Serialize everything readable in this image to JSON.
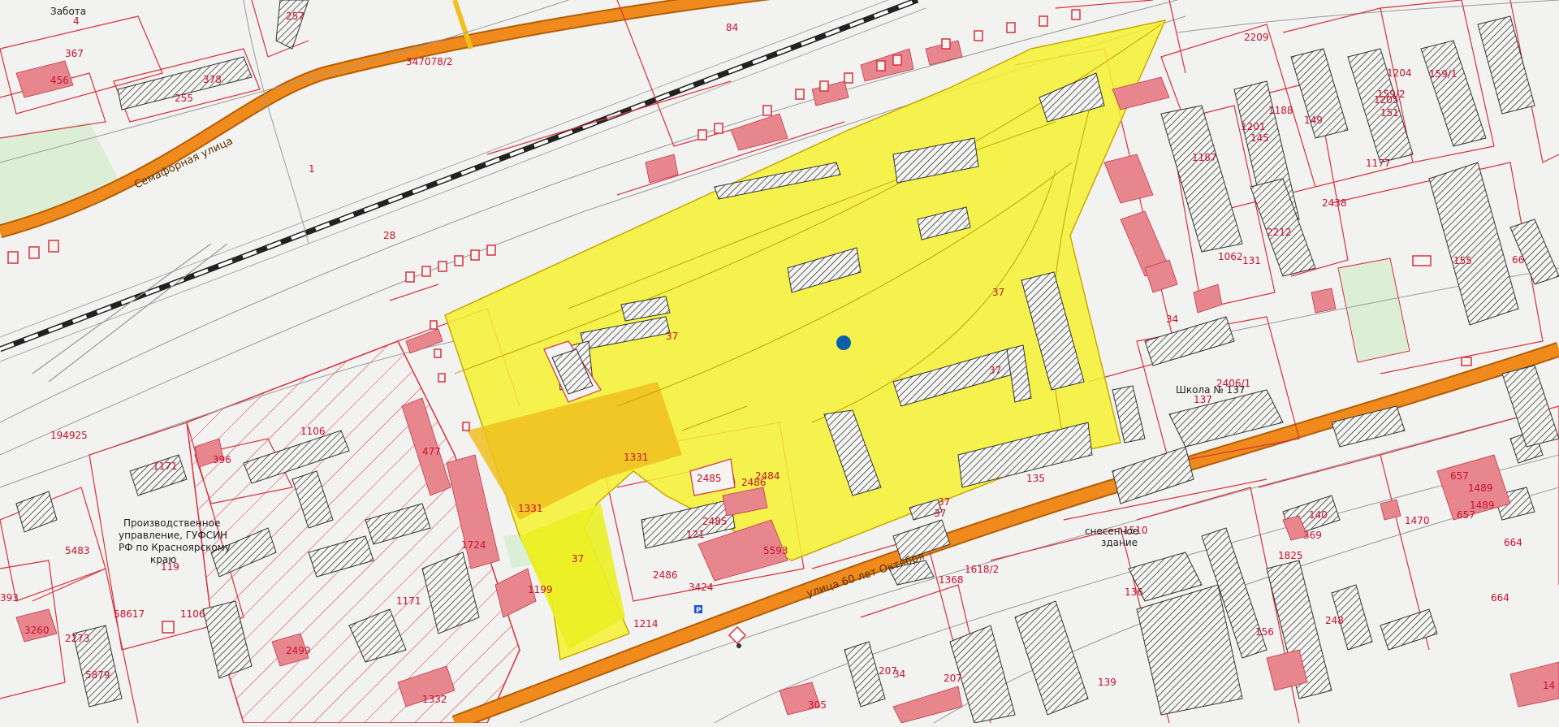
{
  "map": {
    "streets": [
      {
        "name": "Семафорная улица"
      },
      {
        "name": "улица 60 лет Октября"
      }
    ],
    "parcel_numbers": [
      "4",
      "257",
      "367",
      "456",
      "378",
      "255",
      "347078/2",
      "84",
      "1",
      "28",
      "194925",
      "1106",
      "396",
      "1171",
      "5483",
      "119",
      "1171",
      "1106",
      "2499",
      "393",
      "58617",
      "2273",
      "3260",
      "5879",
      "1332",
      "477",
      "1724",
      "37",
      "1331",
      "1331",
      "37",
      "2485",
      "2486",
      "2484",
      "2485",
      "121",
      "5593",
      "2486",
      "3424",
      "1199",
      "1214",
      "37",
      "37",
      "37",
      "135",
      "37",
      "1368",
      "1618/2",
      "305",
      "207",
      "34",
      "207",
      "139",
      "2209",
      "1204",
      "159/1",
      "159/2",
      "1205",
      "1188",
      "149",
      "151",
      "1201",
      "145",
      "1187",
      "1177",
      "2438",
      "1062",
      "131",
      "2212",
      "155",
      "66",
      "34",
      "2406/1",
      "137",
      "664",
      "657",
      "1489",
      "1489",
      "657",
      "1470",
      "140",
      "1825",
      "369",
      "1510",
      "136",
      "156",
      "248",
      "664",
      "14"
    ],
    "labels": {
      "zabota": "Забота",
      "gufsin_1": "Производственное",
      "gufsin_2": "управление, ГУФСИН",
      "gufsin_3": "РФ по Красноярскому",
      "gufsin_4": "краю",
      "school": "Школа № 137",
      "demolished_1": "снесенное",
      "demolished_2": "здание"
    },
    "colors": {
      "highlight": "#f7f230",
      "highlight_dark": "#f0c020",
      "parcel_line": "#d8313d",
      "building_fill": "#e8868e",
      "road": "#f08a1c",
      "marker": "#0b5fa8",
      "green": "#dcefd6"
    },
    "marker_icon": "location-dot-icon",
    "parking_icon": "parking-icon"
  }
}
